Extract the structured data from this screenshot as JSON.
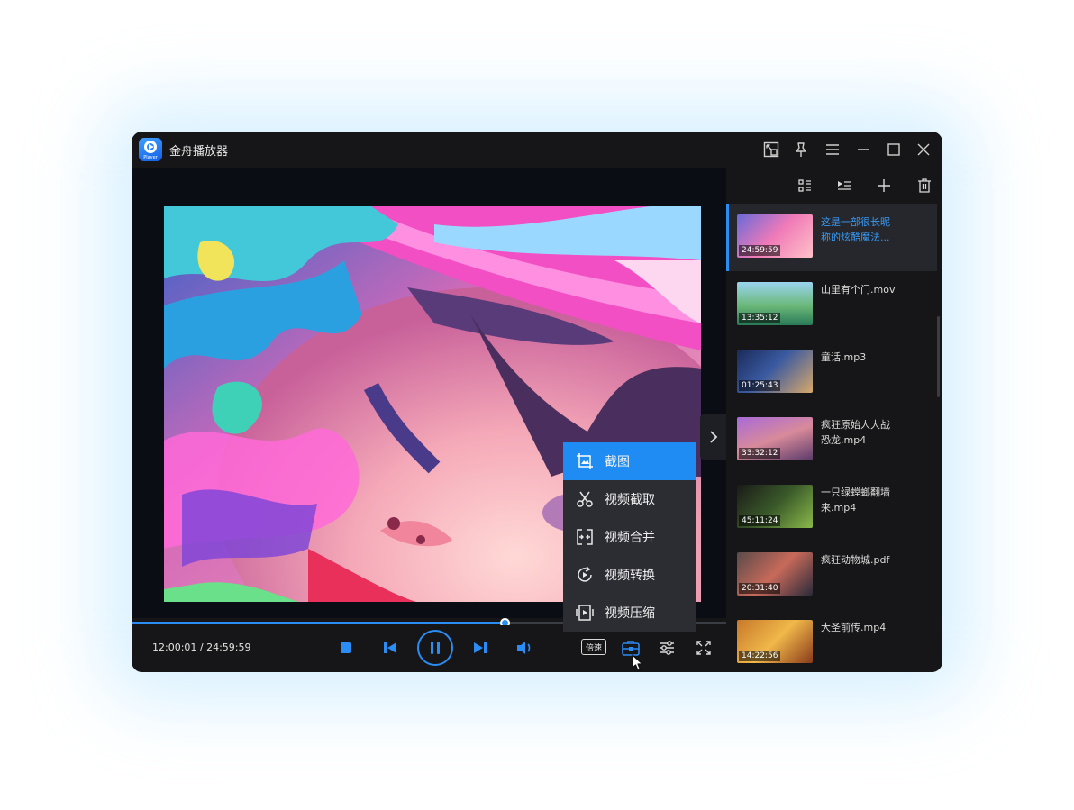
{
  "app": {
    "title": "金舟播放器",
    "logo_text": "Player"
  },
  "player": {
    "time_display": "12:00:01 / 24:59:59",
    "progress": 0.627,
    "speed_label": "倍速",
    "accent_color": "#2b8cf3"
  },
  "tools_menu": {
    "items": [
      {
        "label": "截图",
        "icon": "screenshot-icon",
        "active": true
      },
      {
        "label": "视频截取",
        "icon": "scissors-icon",
        "active": false
      },
      {
        "label": "视频合并",
        "icon": "merge-icon",
        "active": false
      },
      {
        "label": "视频转换",
        "icon": "convert-icon",
        "active": false
      },
      {
        "label": "视频压缩",
        "icon": "compress-icon",
        "active": false
      }
    ]
  },
  "playlist": {
    "items": [
      {
        "title": "这是一部很长昵称的炫酷魔法...",
        "duration": "24:59:59",
        "current": true
      },
      {
        "title": "山里有个门.mov",
        "duration": "13:35:12",
        "current": false
      },
      {
        "title": "童话.mp3",
        "duration": "01:25:43",
        "current": false
      },
      {
        "title": "疯狂原始人大战恐龙.mp4",
        "duration": "33:32:12",
        "current": false
      },
      {
        "title": "一只绿螳螂翻墙来.mp4",
        "duration": "45:11:24",
        "current": false
      },
      {
        "title": "疯狂动物城.pdf",
        "duration": "20:31:40",
        "current": false
      },
      {
        "title": "大圣前传.mp4",
        "duration": "14:22:56",
        "current": false
      }
    ]
  }
}
